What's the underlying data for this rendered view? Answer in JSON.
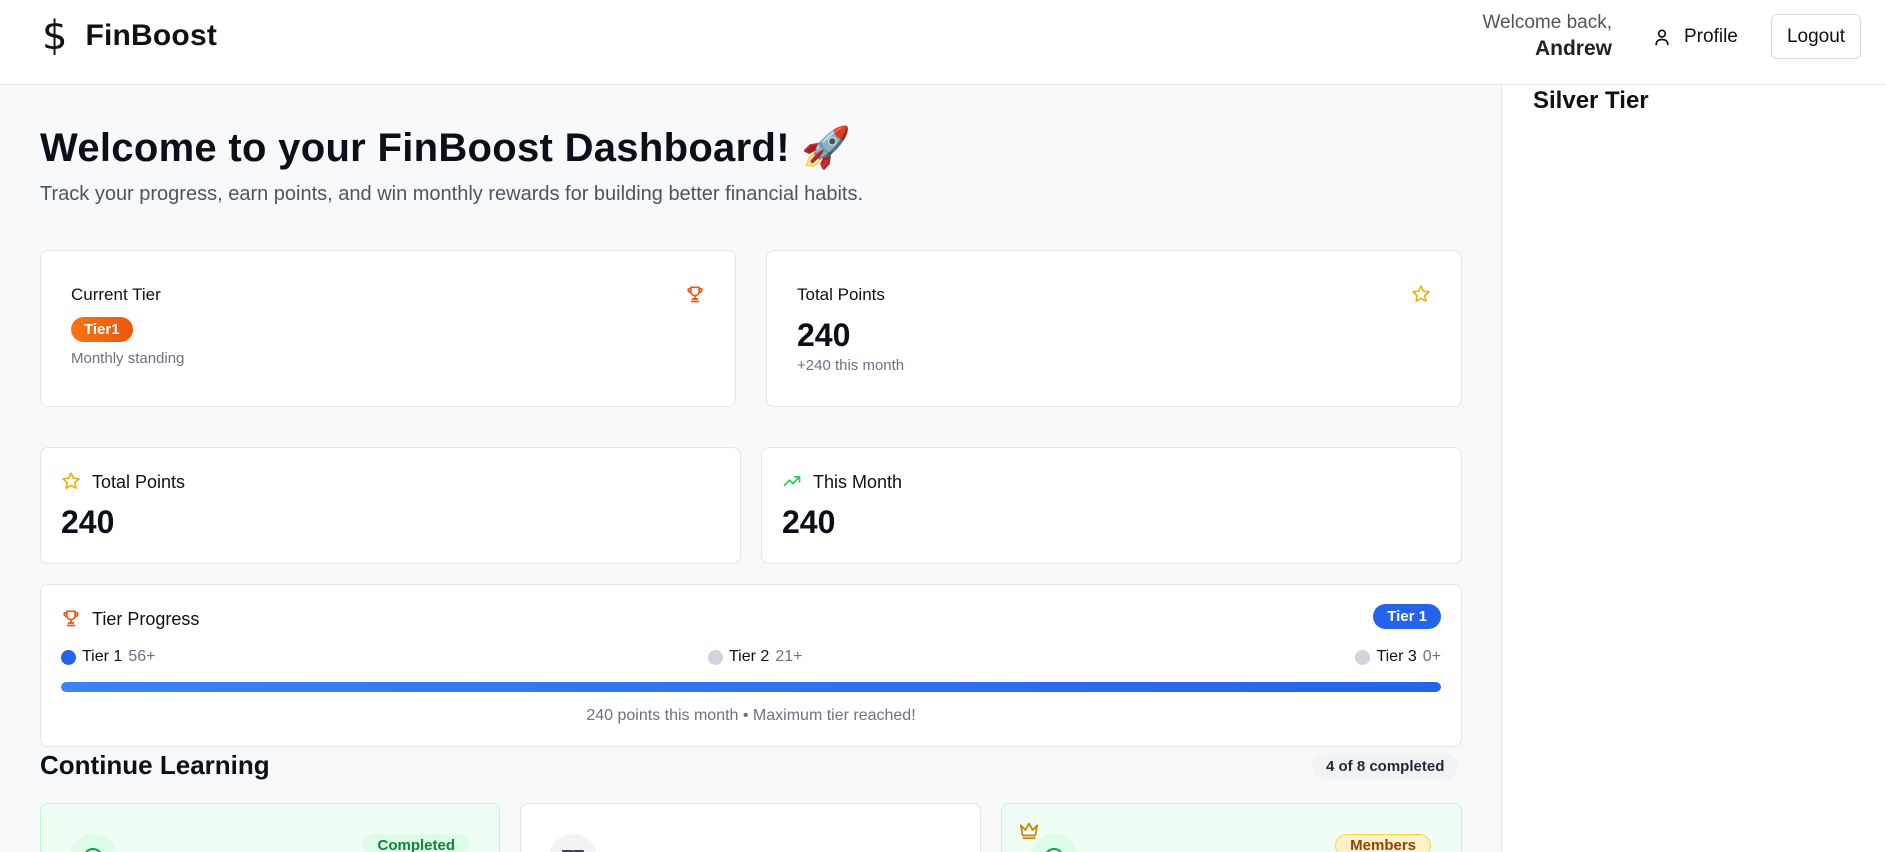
{
  "header": {
    "brand_icon": "dollar-icon",
    "brand_name": "FinBoost",
    "welcome_line": "Welcome back,",
    "user_name": "Andrew",
    "profile_label": "Profile",
    "logout_label": "Logout"
  },
  "sidebar": {
    "title": "Silver Tier"
  },
  "hero": {
    "title": "Welcome to your FinBoost Dashboard! 🚀",
    "subtitle": "Track your progress, earn points, and win monthly rewards for building better financial habits."
  },
  "summary": {
    "current_tier": {
      "label": "Current Tier",
      "badge": "Tier1",
      "note": "Monthly standing",
      "icon": "trophy-icon"
    },
    "total_points": {
      "label": "Total Points",
      "value": "240",
      "note": "+240 this month",
      "icon": "star-icon"
    }
  },
  "stats": {
    "total_points": {
      "label": "Total Points",
      "value": "240",
      "icon": "star-icon"
    },
    "this_month": {
      "label": "This Month",
      "value": "240",
      "icon": "trending-up-icon"
    }
  },
  "tier_progress": {
    "title": "Tier Progress",
    "current_badge": "Tier 1",
    "milestones": [
      {
        "name": "Tier 1",
        "requirement": "56+",
        "active": true
      },
      {
        "name": "Tier 2",
        "requirement": "21+",
        "active": false
      },
      {
        "name": "Tier 3",
        "requirement": "0+",
        "active": false
      }
    ],
    "progress": 1.0,
    "note": "240 points this month • Maximum tier reached!"
  },
  "learning": {
    "title": "Continue Learning",
    "completed_badge": "4 of 8 completed",
    "cards": [
      {
        "badge": "Completed",
        "style": "green",
        "icon": "check-circle-icon"
      },
      {
        "badge": "",
        "style": "plain",
        "icon": "book-icon"
      },
      {
        "badge": "Members",
        "style": "green",
        "icon": "crown-icon"
      }
    ]
  },
  "colors": {
    "accent_blue": "#2563eb",
    "tier_orange": "#f97316",
    "star_yellow": "#eab308",
    "trend_green": "#22c55e"
  }
}
